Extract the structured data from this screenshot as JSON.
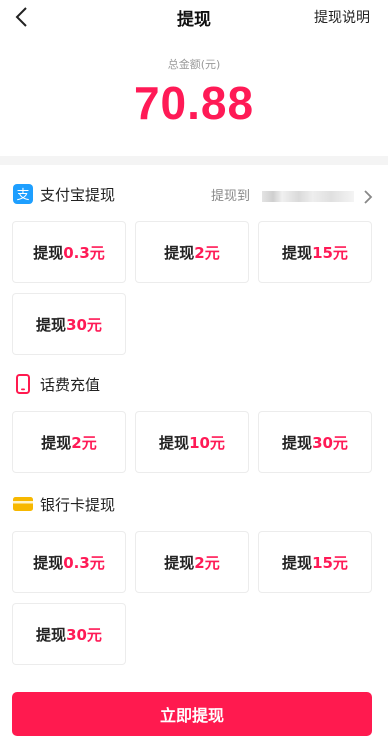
{
  "header": {
    "title": "提现",
    "help": "提现说明"
  },
  "total": {
    "label": "总金额(元)",
    "amount": "70.88"
  },
  "alipay": {
    "title": "支付宝提现",
    "to_label": "提现到",
    "options": [
      {
        "prefix": "提现",
        "amount": "0.3元"
      },
      {
        "prefix": "提现",
        "amount": "2元"
      },
      {
        "prefix": "提现",
        "amount": "15元"
      },
      {
        "prefix": "提现",
        "amount": "30元"
      }
    ]
  },
  "phone": {
    "title": "话费充值",
    "options": [
      {
        "prefix": "提现",
        "amount": "2元"
      },
      {
        "prefix": "提现",
        "amount": "10元"
      },
      {
        "prefix": "提现",
        "amount": "30元"
      }
    ]
  },
  "bank": {
    "title": "银行卡提现",
    "options": [
      {
        "prefix": "提现",
        "amount": "0.3元"
      },
      {
        "prefix": "提现",
        "amount": "2元"
      },
      {
        "prefix": "提现",
        "amount": "15元"
      },
      {
        "prefix": "提现",
        "amount": "30元"
      }
    ]
  },
  "submit": {
    "label": "立即提现"
  },
  "colors": {
    "accent": "#ff1a56",
    "alipay": "#1e9fff",
    "phone": "#ff1a4f",
    "bank": "#f7b800"
  }
}
